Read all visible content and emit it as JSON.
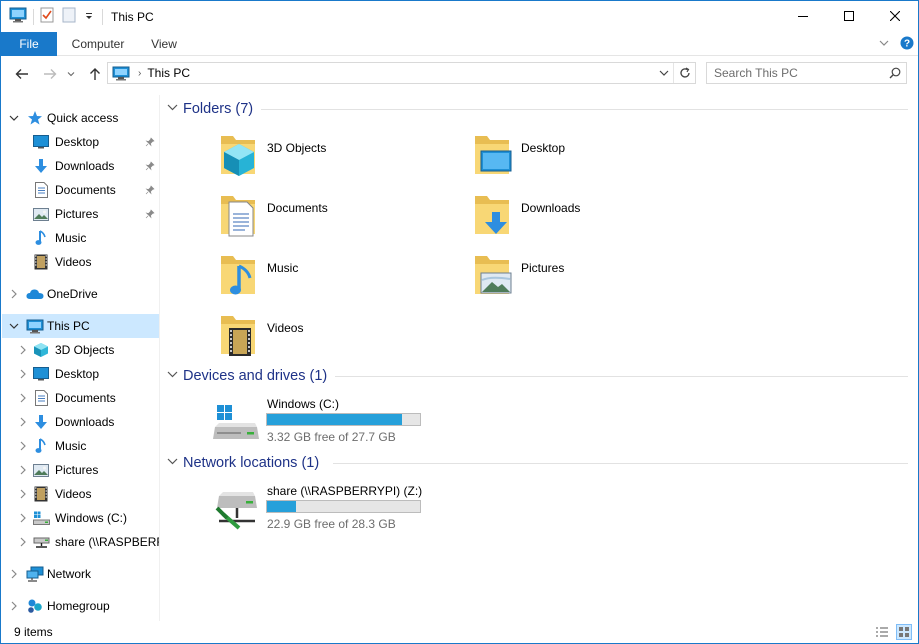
{
  "window": {
    "title": "This PC",
    "accent": "#1979ca",
    "controls": [
      "minimize-icon",
      "maximize-icon",
      "close-icon"
    ]
  },
  "ribbon": {
    "tabs": [
      "File",
      "Computer",
      "View"
    ]
  },
  "address": {
    "path": "This PC",
    "search_placeholder": "Search This PC"
  },
  "nav": {
    "items": [
      {
        "label": "Quick access",
        "icon": "star-icon"
      },
      {
        "label": "Desktop",
        "icon": "desktop-icon",
        "pinned": true
      },
      {
        "label": "Downloads",
        "icon": "download-icon",
        "pinned": true
      },
      {
        "label": "Documents",
        "icon": "document-icon",
        "pinned": true
      },
      {
        "label": "Pictures",
        "icon": "picture-icon",
        "pinned": true
      },
      {
        "label": "Music",
        "icon": "music-icon"
      },
      {
        "label": "Videos",
        "icon": "video-icon"
      },
      {
        "label": "OneDrive",
        "icon": "cloud-icon"
      },
      {
        "label": "This PC",
        "icon": "computer-icon",
        "selected": true
      },
      {
        "label": "3D Objects",
        "icon": "cube-icon"
      },
      {
        "label": "Desktop",
        "icon": "desktop-icon"
      },
      {
        "label": "Documents",
        "icon": "document-icon"
      },
      {
        "label": "Downloads",
        "icon": "download-icon"
      },
      {
        "label": "Music",
        "icon": "music-icon"
      },
      {
        "label": "Pictures",
        "icon": "picture-icon"
      },
      {
        "label": "Videos",
        "icon": "video-icon"
      },
      {
        "label": "Windows (C:)",
        "icon": "drive-icon"
      },
      {
        "label": "share (\\\\RASPBERRYPI) (Z:)",
        "icon": "network-drive-icon"
      },
      {
        "label": "Network",
        "icon": "network-icon"
      },
      {
        "label": "Homegroup",
        "icon": "homegroup-icon"
      }
    ]
  },
  "content": {
    "folders_header": "Folders (7)",
    "folders": [
      "3D Objects",
      "Desktop",
      "Documents",
      "Downloads",
      "Music",
      "Pictures",
      "Videos"
    ],
    "devices_header": "Devices and drives (1)",
    "devices": [
      {
        "name": "Windows (C:)",
        "free_text": "3.32 GB free of 27.7 GB",
        "used_fraction": 0.88
      }
    ],
    "network_header": "Network locations (1)",
    "network": [
      {
        "name": "share (\\\\RASPBERRYPI) (Z:)",
        "free_text": "22.9 GB free of 28.3 GB",
        "used_fraction": 0.19
      }
    ]
  },
  "status": {
    "items_text": "9 items"
  }
}
